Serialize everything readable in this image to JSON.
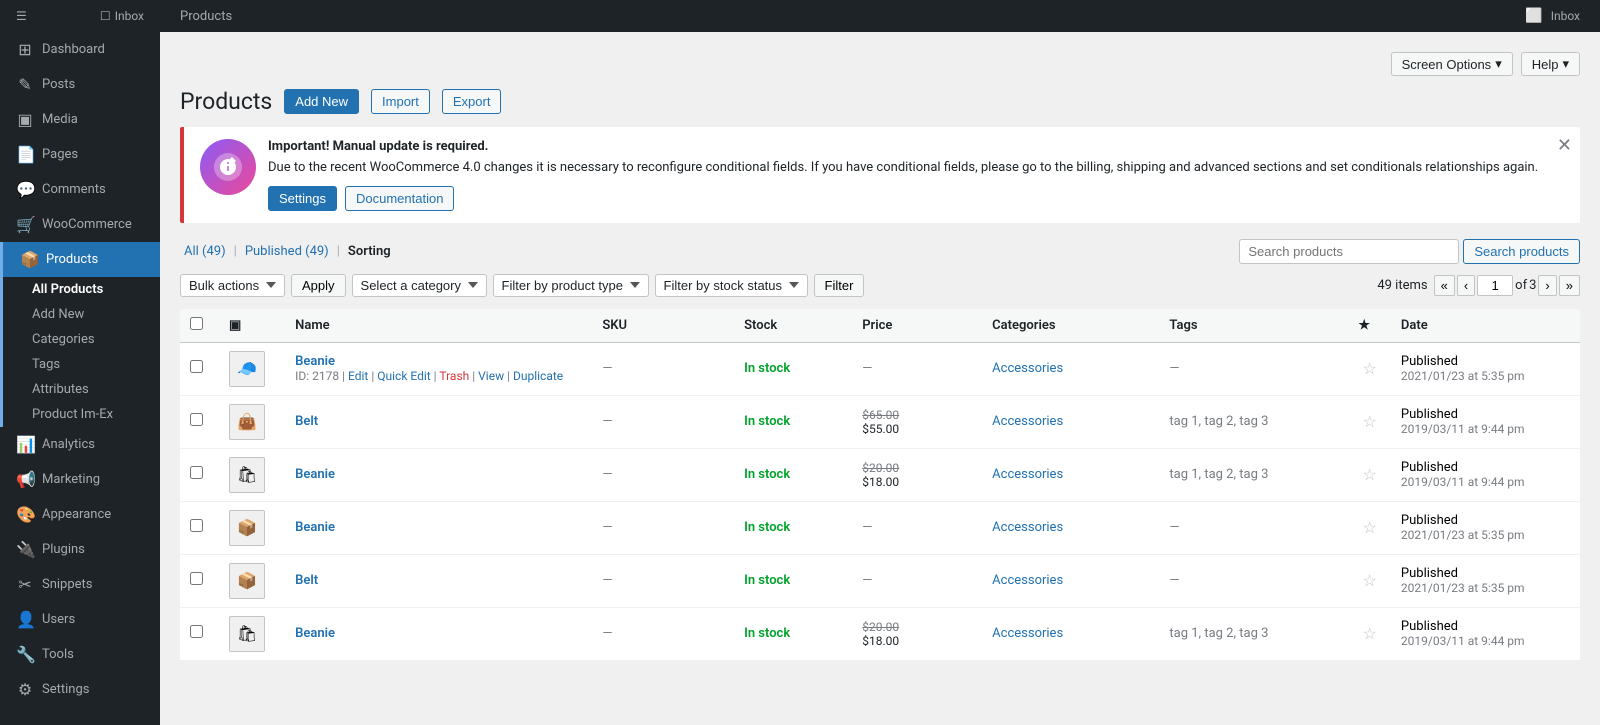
{
  "topbar": {
    "title": "Products",
    "inbox_label": "Inbox"
  },
  "screen_options": {
    "screen_options_label": "Screen Options",
    "help_label": "Help"
  },
  "sidebar": {
    "items": [
      {
        "id": "dashboard",
        "label": "Dashboard",
        "icon": "⊞"
      },
      {
        "id": "posts",
        "label": "Posts",
        "icon": "✎"
      },
      {
        "id": "media",
        "label": "Media",
        "icon": "▣"
      },
      {
        "id": "pages",
        "label": "Pages",
        "icon": "📄"
      },
      {
        "id": "comments",
        "label": "Comments",
        "icon": "💬"
      },
      {
        "id": "woocommerce",
        "label": "WooCommerce",
        "icon": "🛒"
      },
      {
        "id": "products",
        "label": "Products",
        "icon": "📦",
        "active": true
      },
      {
        "id": "analytics",
        "label": "Analytics",
        "icon": "📊"
      },
      {
        "id": "marketing",
        "label": "Marketing",
        "icon": "📢"
      },
      {
        "id": "appearance",
        "label": "Appearance",
        "icon": "🎨"
      },
      {
        "id": "plugins",
        "label": "Plugins",
        "icon": "🔌"
      },
      {
        "id": "snippets",
        "label": "Snippets",
        "icon": "✂"
      },
      {
        "id": "users",
        "label": "Users",
        "icon": "👤"
      },
      {
        "id": "tools",
        "label": "Tools",
        "icon": "🔧"
      },
      {
        "id": "settings",
        "label": "Settings",
        "icon": "⚙"
      }
    ],
    "sub_items": [
      {
        "id": "all-products",
        "label": "All Products",
        "active": true
      },
      {
        "id": "add-new",
        "label": "Add New"
      },
      {
        "id": "categories",
        "label": "Categories"
      },
      {
        "id": "tags",
        "label": "Tags"
      },
      {
        "id": "attributes",
        "label": "Attributes"
      },
      {
        "id": "product-im-ex",
        "label": "Product Im-Ex"
      }
    ]
  },
  "page": {
    "title": "Products",
    "buttons": {
      "add_new": "Add New",
      "import": "Import",
      "export": "Export"
    }
  },
  "notice": {
    "title": "Important! Manual update is required.",
    "text": "Due to the recent WooCommerce 4.0 changes it is necessary to reconfigure conditional fields. If you have conditional fields, please go to the billing, shipping and advanced sections and set conditionals relationships again.",
    "settings_btn": "Settings",
    "docs_btn": "Documentation"
  },
  "tabs": {
    "all": "All (49)",
    "published": "Published (49)",
    "sorting": "Sorting"
  },
  "search": {
    "placeholder": "Search products",
    "button": "Search products"
  },
  "filters": {
    "bulk_actions_label": "Bulk actions",
    "apply_label": "Apply",
    "select_category_label": "Select a category",
    "filter_by_type_label": "Filter by product type",
    "filter_by_stock_label": "Filter by stock status",
    "filter_btn_label": "Filter",
    "items_count": "49 items",
    "page_current": "1",
    "page_total": "3"
  },
  "table": {
    "headers": {
      "name": "Name",
      "sku": "SKU",
      "stock": "Stock",
      "price": "Price",
      "categories": "Categories",
      "tags": "Tags",
      "date": "Date"
    },
    "rows": [
      {
        "id": "2178",
        "name": "Beanie",
        "sku": "—",
        "stock": "In stock",
        "price_original": "",
        "price_sale": "",
        "categories": "Accessories",
        "tags": "—",
        "featured": false,
        "date": "Published",
        "date2": "2021/01/23 at 5:35 pm",
        "thumb_icon": "🧢"
      },
      {
        "id": "",
        "name": "Belt",
        "sku": "—",
        "stock": "In stock",
        "price_original": "$65.00",
        "price_sale": "$55.00",
        "categories": "Accessories",
        "tags": "tag 1, tag 2, tag 3",
        "featured": false,
        "date": "Published",
        "date2": "2019/03/11 at 9:44 pm",
        "thumb_icon": "👜"
      },
      {
        "id": "",
        "name": "Beanie",
        "sku": "—",
        "stock": "In stock",
        "price_original": "$20.00",
        "price_sale": "$18.00",
        "categories": "Accessories",
        "tags": "tag 1, tag 2, tag 3",
        "featured": false,
        "date": "Published",
        "date2": "2019/03/11 at 9:44 pm",
        "thumb_icon": "🛍"
      },
      {
        "id": "",
        "name": "Beanie",
        "sku": "—",
        "stock": "In stock",
        "price_original": "",
        "price_sale": "",
        "categories": "Accessories",
        "tags": "—",
        "featured": false,
        "date": "Published",
        "date2": "2021/01/23 at 5:35 pm",
        "thumb_icon": "📦"
      },
      {
        "id": "",
        "name": "Belt",
        "sku": "—",
        "stock": "In stock",
        "price_original": "",
        "price_sale": "",
        "categories": "Accessories",
        "tags": "—",
        "featured": false,
        "date": "Published",
        "date2": "2021/01/23 at 5:35 pm",
        "thumb_icon": "📦"
      },
      {
        "id": "",
        "name": "Beanie",
        "sku": "—",
        "stock": "In stock",
        "price_original": "$20.00",
        "price_sale": "$18.00",
        "categories": "Accessories",
        "tags": "tag 1, tag 2, tag 3",
        "featured": false,
        "date": "Published",
        "date2": "2019/03/11 at 9:44 pm",
        "thumb_icon": "🛍"
      }
    ]
  }
}
